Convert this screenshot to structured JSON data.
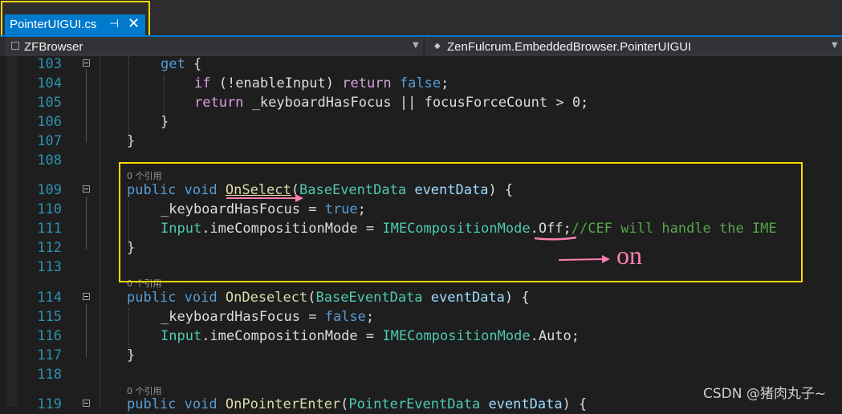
{
  "tab": {
    "title": "PointerUIGUI.cs",
    "pin_icon": "pin-icon",
    "close_icon": "close-icon"
  },
  "navbar": {
    "project": "ZFBrowser",
    "member": "ZenFulcrum.EmbeddedBrowser.PointerUIGUI"
  },
  "lens_text": "0 个引用",
  "lines": [
    {
      "n": "103",
      "code": "get {"
    },
    {
      "n": "104",
      "code": "if (!enableInput) return false;"
    },
    {
      "n": "105",
      "code": "return _keyboardHasFocus || focusForceCount > 0;"
    },
    {
      "n": "106",
      "code": "}"
    },
    {
      "n": "107",
      "code": "}"
    },
    {
      "n": "108",
      "code": ""
    },
    {
      "n": "109",
      "code": "public void OnSelect(BaseEventData eventData) {"
    },
    {
      "n": "110",
      "code": "_keyboardHasFocus = true;"
    },
    {
      "n": "111",
      "code": "Input.imeCompositionMode = IMECompositionMode.Off;//CEF will handle the IME"
    },
    {
      "n": "112",
      "code": "}"
    },
    {
      "n": "113",
      "code": ""
    },
    {
      "n": "114",
      "code": "public void OnDeselect(BaseEventData eventData) {"
    },
    {
      "n": "115",
      "code": "_keyboardHasFocus = false;"
    },
    {
      "n": "116",
      "code": "Input.imeCompositionMode = IMECompositionMode.Auto;"
    },
    {
      "n": "117",
      "code": "}"
    },
    {
      "n": "118",
      "code": ""
    },
    {
      "n": "119",
      "code": "public void OnPointerEnter(PointerEventData eventData) {"
    }
  ],
  "annotation": {
    "text": "on",
    "color": "#ff7fb0",
    "box_color": "#ffd700"
  },
  "watermark": "CSDN @猪肉丸子~",
  "colors": {
    "accent": "#007acc",
    "keyword": "#569cd6",
    "type": "#4ec9b0",
    "comment": "#57a64a",
    "line_number": "#2b91af"
  }
}
